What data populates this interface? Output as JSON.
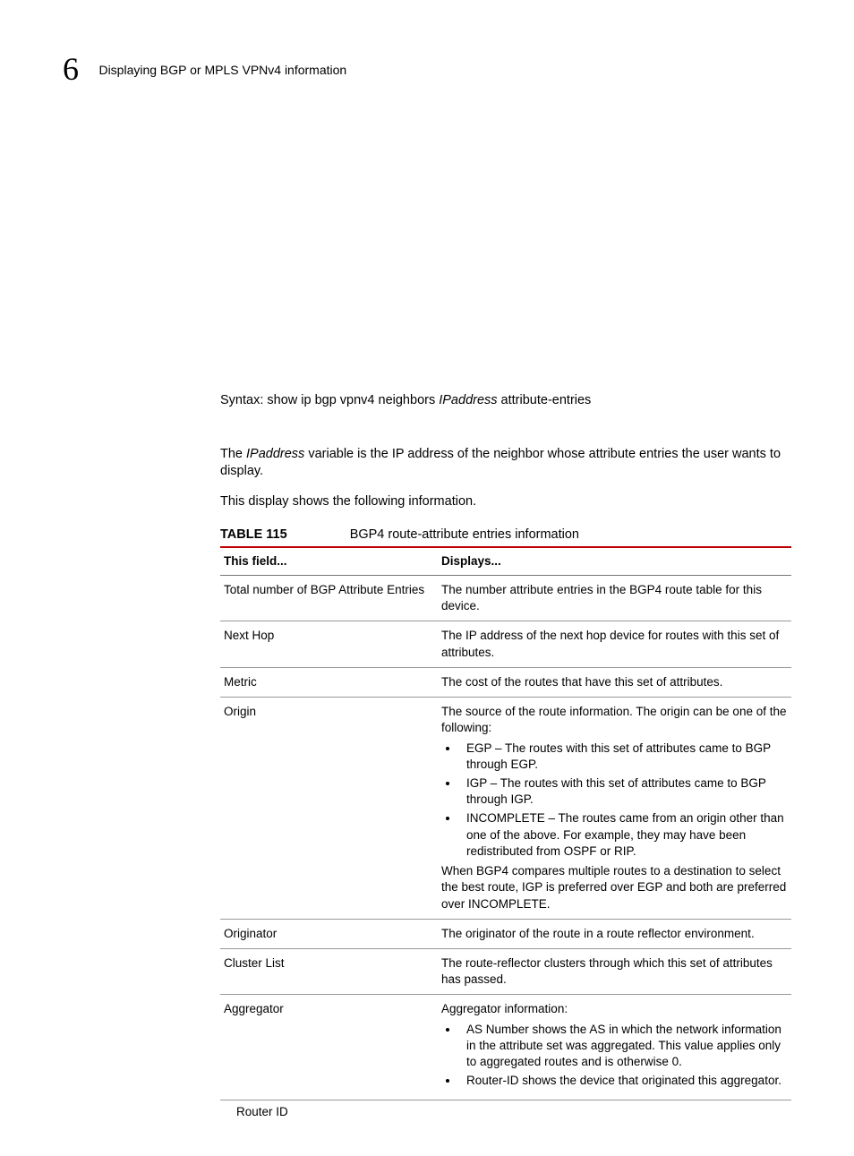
{
  "header": {
    "chapter_number": "6",
    "title": "Displaying BGP or MPLS VPNv4 information"
  },
  "syntax": {
    "prefix": "Syntax:  show ip bgp vpnv4 neighbors ",
    "variable": "IPaddress",
    "suffix": " attribute-entries"
  },
  "paragraphs": {
    "p1_pre": "The ",
    "p1_var": "IPaddress",
    "p1_post": " variable is the IP address of the neighbor whose attribute entries the user wants to display.",
    "p2": "This display shows the following information."
  },
  "table": {
    "label": "TABLE 115",
    "caption": "BGP4 route-attribute entries information",
    "head_field": "This field...",
    "head_displays": "Displays...",
    "rows": [
      {
        "field": "Total number of BGP Attribute Entries",
        "text": "The number attribute entries in the BGP4 route table for this device."
      },
      {
        "field": "Next Hop",
        "text": "The IP address of the next hop device for routes with this set of attributes."
      },
      {
        "field": "Metric",
        "text": "The cost of the routes that have this set of attributes."
      },
      {
        "field": "Origin",
        "pre": "The source of the route information. The origin can be one of the following:",
        "bullets": [
          "EGP – The routes with this set of attributes came to BGP through EGP.",
          "IGP – The routes with this set of attributes came to BGP through IGP.",
          "INCOMPLETE – The routes came from an origin other than one of the above. For example, they may have been redistributed from OSPF or RIP."
        ],
        "post": "When BGP4 compares multiple routes to a destination to select the best route, IGP is preferred over EGP and both are preferred over INCOMPLETE."
      },
      {
        "field": "Originator",
        "text": "The originator of the route in a route reflector environment."
      },
      {
        "field": "Cluster List",
        "text": "The route-reflector clusters through which this set of attributes has passed."
      },
      {
        "field": "Aggregator",
        "pre": "Aggregator information:",
        "bullets": [
          "AS Number shows the AS in which the network information in the attribute set was aggregated. This value applies only to aggregated routes and is otherwise 0.",
          "Router-ID shows the device that originated this aggregator."
        ]
      }
    ],
    "below": "Router ID"
  }
}
